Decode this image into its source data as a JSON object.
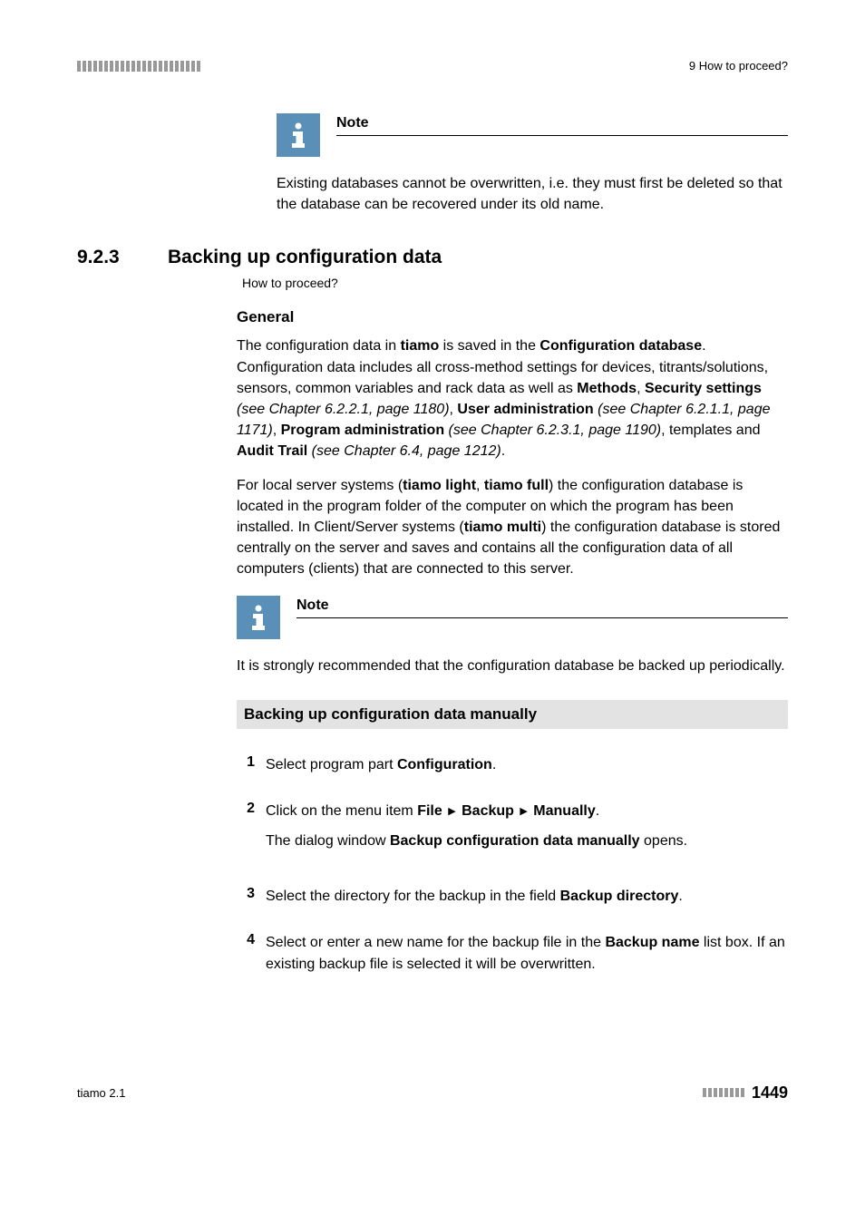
{
  "header": {
    "breadcrumb_right": "9 How to proceed?"
  },
  "note1": {
    "title": "Note",
    "text": "Existing databases cannot be overwritten, i.e. they must first be deleted so that the database can be recovered under its old name."
  },
  "section": {
    "number": "9.2.3",
    "title": "Backing up configuration data",
    "breadcrumb": "How to proceed?"
  },
  "general": {
    "heading": "General",
    "p1_a": "The configuration data in ",
    "p1_b": "tiamo",
    "p1_c": " is saved in the ",
    "p1_d": "Configuration database",
    "p1_e": ". Configuration data includes all cross-method settings for devices, titrants/solutions, sensors, common variables and rack data as well as ",
    "p1_f": "Methods",
    "p1_g": ", ",
    "p1_h": "Security settings",
    "p1_i": " (see Chapter 6.2.2.1, page 1180)",
    "p1_j": ", ",
    "p1_k": "User administration",
    "p1_l": " (see Chapter 6.2.1.1, page 1171)",
    "p1_m": ", ",
    "p1_n": "Program administration",
    "p1_o": " (see Chapter 6.2.3.1, page 1190)",
    "p1_p": ", templates and ",
    "p1_q": "Audit Trail",
    "p1_r": " (see Chapter 6.4, page 1212)",
    "p1_s": ".",
    "p2_a": "For local server systems (",
    "p2_b": "tiamo light",
    "p2_c": ", ",
    "p2_d": "tiamo full",
    "p2_e": ") the configuration database is located in the program folder of the computer on which the program has been installed. In Client/Server systems (",
    "p2_f": "tiamo multi",
    "p2_g": ") the configuration database is stored centrally on the server and saves and contains all the configuration data of all computers (clients) that are connected to this server."
  },
  "note2": {
    "title": "Note",
    "text": "It is strongly recommended that the configuration database be backed up periodically."
  },
  "manual": {
    "heading": "Backing up configuration data manually"
  },
  "steps": {
    "s1_a": "Select program part ",
    "s1_b": "Configuration",
    "s1_c": ".",
    "s2_a": "Click on the menu item ",
    "s2_b": "File",
    "s2_c": "Backup",
    "s2_d": "Manually",
    "s2_e": ".",
    "s2_f": "The dialog window ",
    "s2_g": "Backup configuration data manually",
    "s2_h": " opens.",
    "s3_a": "Select the directory for the backup in the field ",
    "s3_b": "Backup directory",
    "s3_c": ".",
    "s4_a": "Select or enter a new name for the backup file in the ",
    "s4_b": "Backup name",
    "s4_c": " list box. If an existing backup file is selected it will be overwritten."
  },
  "footer": {
    "left": "tiamo 2.1",
    "page": "1449"
  }
}
